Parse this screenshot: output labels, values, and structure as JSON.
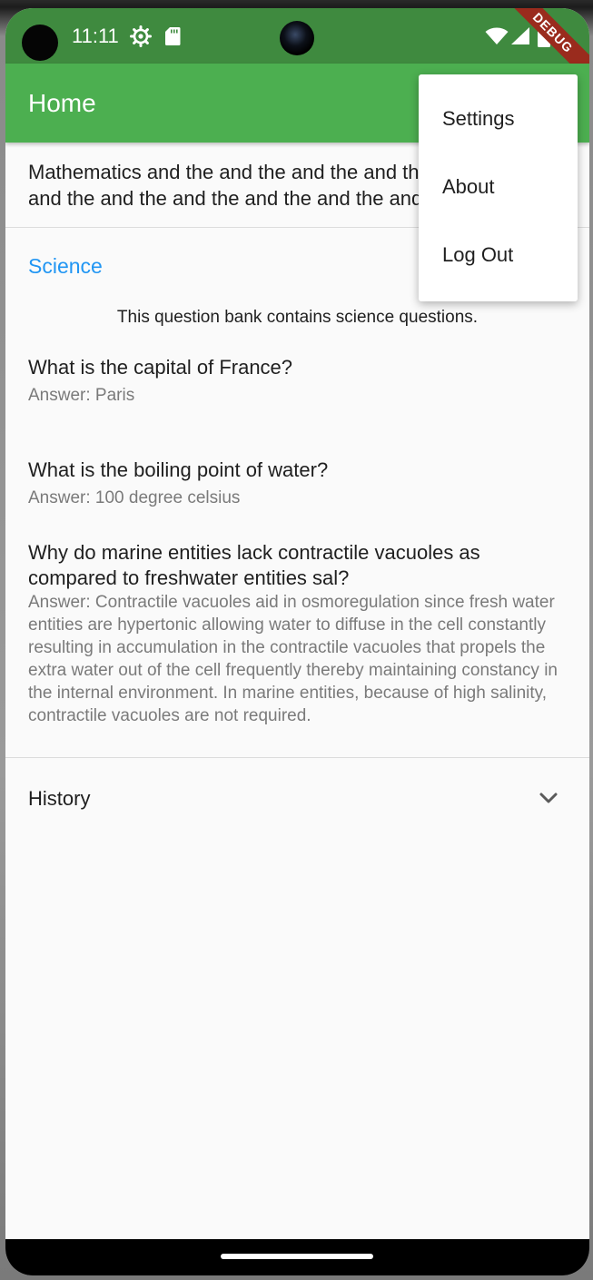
{
  "status_bar": {
    "time": "11:11",
    "debug_label": "DEBUG"
  },
  "app_bar": {
    "title": "Home"
  },
  "math_tile": {
    "text_line1": "Mathematics and the and the and the and the and the",
    "text_line2": "and the and the and the and the and the and the"
  },
  "science_section": {
    "header": "Science",
    "description": "This question bank contains science questions.",
    "items": [
      {
        "question": "What is the capital of France?",
        "answer": "Answer: Paris"
      },
      {
        "question": "What is the boiling point of water?",
        "answer": "Answer: 100 degree celsius"
      },
      {
        "question": "Why do marine entities lack contractile vacuoles as compared to freshwater entities sal?",
        "answer": "Answer: Contractile vacuoles aid in osmoregulation since fresh water entities are hypertonic allowing water to diffuse in the cell constantly resulting in accumulation in the contractile vacuoles that propels the extra water out of the cell frequently thereby maintaining constancy in the internal environment. In marine entities, because of high salinity, contractile vacuoles are not required."
      }
    ]
  },
  "history_section": {
    "label": "History"
  },
  "popup_menu": {
    "items": [
      "Settings",
      "About",
      "Log Out"
    ]
  },
  "colors": {
    "status_bar": "#3f8a3f",
    "app_bar": "#4caf50",
    "section_header": "#2196f3",
    "debug_ribbon": "#9a2b1d"
  }
}
